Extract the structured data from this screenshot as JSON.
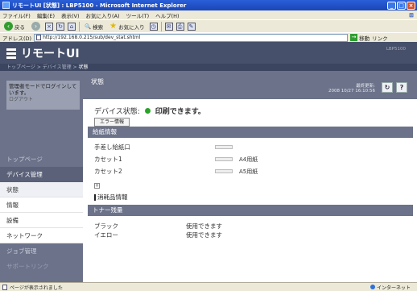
{
  "window": {
    "title": "リモートUI [状態] : LBP5100 - Microsoft Internet Explorer",
    "minimize": "_",
    "maximize": "□",
    "close": "×"
  },
  "menu": [
    "ファイル(F)",
    "編集(E)",
    "表示(V)",
    "お気に入り(A)",
    "ツール(T)",
    "ヘルプ(H)"
  ],
  "toolbar": {
    "back": "戻る",
    "search": "検索",
    "favorites": "お気に入り"
  },
  "address": {
    "label": "アドレス(D)",
    "url": "http://192.168.0.215/sub/dev_stat.shtml",
    "go": "移動",
    "links": "リンク"
  },
  "header": {
    "brand": "リモートUI",
    "model": "LBP5100"
  },
  "breadcrumb": {
    "top": "トップページ",
    "device": "デバイス管理",
    "current": "状態",
    "sep": ">"
  },
  "sidebar": {
    "login_text": "管理者モードでログインしています。",
    "logout": "ログアウト",
    "items": [
      {
        "label": "トップページ"
      },
      {
        "label": "デバイス管理"
      },
      {
        "label": "状態"
      },
      {
        "label": "情報"
      },
      {
        "label": "設備"
      },
      {
        "label": "ネットワーク"
      },
      {
        "label": "ジョブ管理"
      },
      {
        "label": "サポートリンク"
      }
    ]
  },
  "main": {
    "title": "状態",
    "last_update_label": "最終更新:",
    "last_update_value": "2008 10/27 16:10:56",
    "refresh_icon": "refresh-icon",
    "help": "?"
  },
  "device_status": {
    "label": "デバイス状態:",
    "value": "印刷できます。",
    "error_button": "エラー情報",
    "color": "#29a329"
  },
  "paper": {
    "section": "給紙情報",
    "rows": [
      {
        "label": "手差し給紙口",
        "size": ""
      },
      {
        "label": "カセット1",
        "size": "A4用紙"
      },
      {
        "label": "カセット2",
        "size": "A5用紙"
      }
    ]
  },
  "consumables": {
    "expand": "+",
    "title": "消耗品情報"
  },
  "toner": {
    "section": "トナー残量",
    "rows": [
      {
        "label": "ブラック",
        "value": "使用できます"
      },
      {
        "label": "イエロー",
        "value": "使用できます"
      }
    ]
  },
  "statusbar": {
    "text": "ページが表示されました",
    "zone": "インターネット"
  }
}
